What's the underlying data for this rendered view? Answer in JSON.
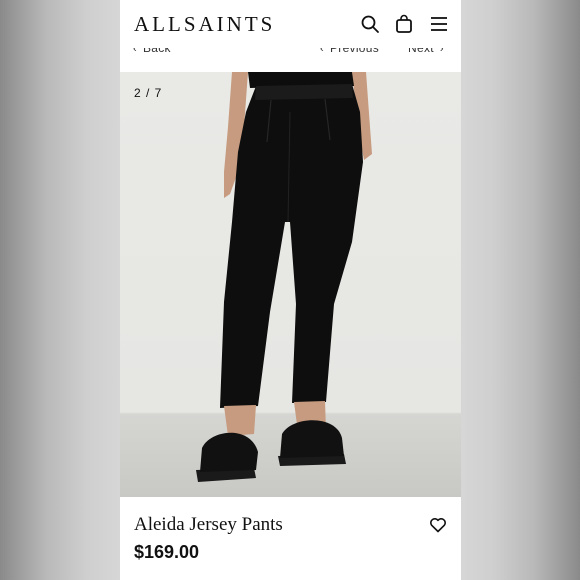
{
  "header": {
    "brand": "ALLSAINTS",
    "icons": [
      "search-icon",
      "bag-icon",
      "menu-icon"
    ]
  },
  "nav": {
    "back_label": "Back",
    "previous_label": "Previous",
    "next_label": "Next"
  },
  "gallery": {
    "counter": "2 / 7"
  },
  "product": {
    "name": "Aleida Jersey Pants",
    "price": "$169.00"
  },
  "colors": {
    "text": "#111111",
    "background": "#ffffff",
    "product": "#0d0d0d"
  }
}
